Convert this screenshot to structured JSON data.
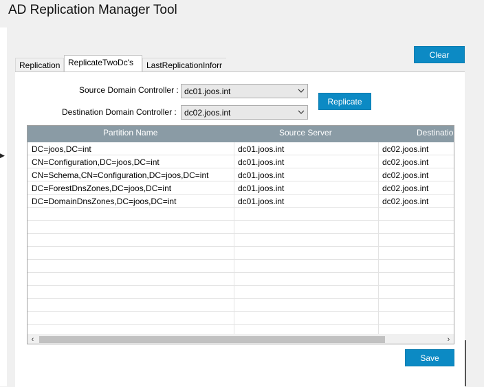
{
  "window": {
    "title": "AD Replication Manager Tool"
  },
  "buttons": {
    "clear": "Clear",
    "replicate": "Replicate",
    "save": "Save"
  },
  "tabs": [
    {
      "label": "Replication"
    },
    {
      "label": "ReplicateTwoDc's"
    },
    {
      "label": "LastReplicationInforr"
    }
  ],
  "form": {
    "source_label": "Source Domain Controller :",
    "source_value": "dc01.joos.int",
    "destination_label": "Destination Domain Controller :",
    "destination_value": "dc02.joos.int"
  },
  "grid": {
    "columns": [
      "Partition Name",
      "Source Server",
      "Destinatio"
    ],
    "rows": [
      [
        "DC=joos,DC=int",
        "dc01.joos.int",
        "dc02.joos.int"
      ],
      [
        "CN=Configuration,DC=joos,DC=int",
        "dc01.joos.int",
        "dc02.joos.int"
      ],
      [
        "CN=Schema,CN=Configuration,DC=joos,DC=int",
        "dc01.joos.int",
        "dc02.joos.int"
      ],
      [
        "DC=ForestDnsZones,DC=joos,DC=int",
        "dc01.joos.int",
        "dc02.joos.int"
      ],
      [
        "DC=DomainDnsZones,DC=joos,DC=int",
        "dc01.joos.int",
        "dc02.joos.int"
      ]
    ]
  },
  "icons": {
    "dropdown": "chevron-down-icon",
    "scroll_left": "chevron-left-icon",
    "scroll_right": "chevron-right-icon",
    "side_arrow": "triangle-right-icon"
  },
  "colors": {
    "accent": "#0c8ac4",
    "grid_header": "#8a9ba5"
  }
}
